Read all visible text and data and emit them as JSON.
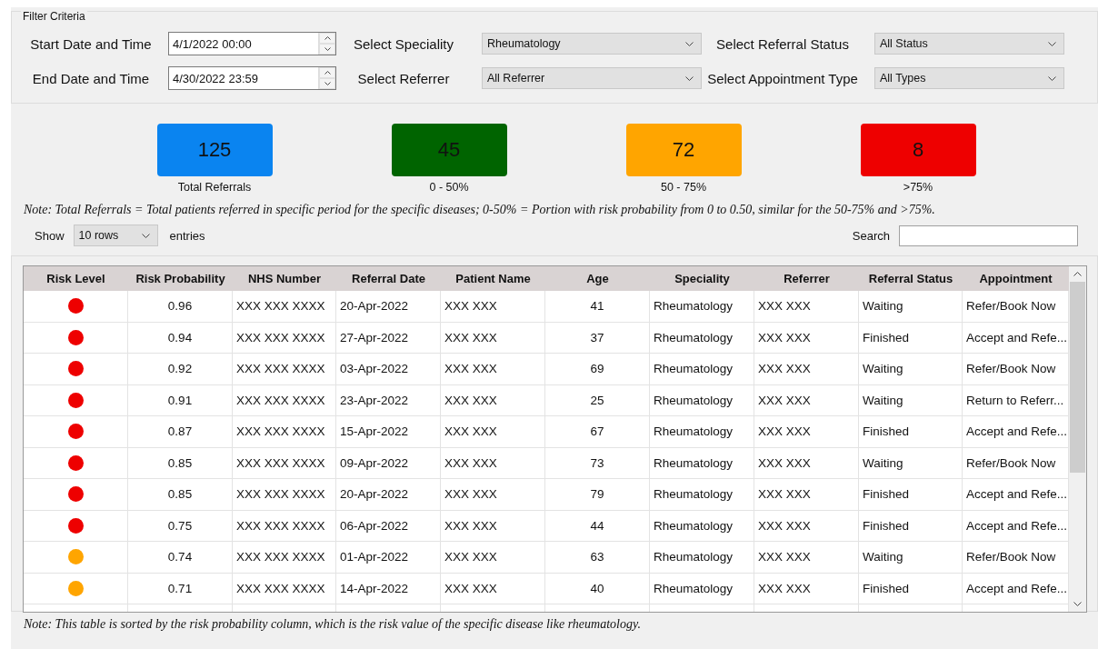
{
  "filter": {
    "title": "Filter Criteria",
    "fields": [
      {
        "kind": "datetime",
        "label": "Start Date and Time",
        "value": "4/1/2022 00:00"
      },
      {
        "kind": "dropdown",
        "label": "Select Speciality",
        "value": "Rheumatology"
      },
      {
        "kind": "dropdown",
        "label": "Select Referral Status",
        "value": "All Status"
      },
      {
        "kind": "datetime",
        "label": "End Date and Time",
        "value": "4/30/2022 23:59"
      },
      {
        "kind": "dropdown",
        "label": "Select Referrer",
        "value": "All Referrer"
      },
      {
        "kind": "dropdown",
        "label": "Select Appointment Type",
        "value": "All Types"
      }
    ]
  },
  "summary_cards": [
    {
      "value": "125",
      "label": "Total Referrals",
      "color": "#0a84f0"
    },
    {
      "value": "45",
      "label": "0 - 50%",
      "color": "#006400"
    },
    {
      "value": "72",
      "label": "50 - 75%",
      "color": "#ffa500"
    },
    {
      "value": "8",
      "label": ">75%",
      "color": "#ee0000"
    }
  ],
  "summary_note": "Note: Total Referrals = Total patients referred in specific period for the specific diseases; 0-50% = Portion with risk probability from 0 to 0.50, similar for the 50-75% and >75%.",
  "entries": {
    "show_label": "Show",
    "value": "10 rows",
    "suffix": "entries"
  },
  "search": {
    "label": "Search"
  },
  "table": {
    "columns": [
      "Risk Level",
      "Risk Probability",
      "NHS Number",
      "Referral Date",
      "Patient Name",
      "Age",
      "Speciality",
      "Referrer",
      "Referral Status",
      "Appointment"
    ],
    "rows": [
      {
        "color": "#ee0000",
        "cells": [
          "",
          "0.96",
          "XXX XXX XXXX",
          "20-Apr-2022",
          "XXX XXX",
          "41",
          "Rheumatology",
          "XXX XXX",
          "Waiting",
          "Refer/Book Now"
        ]
      },
      {
        "color": "#ee0000",
        "cells": [
          "",
          "0.94",
          "XXX XXX XXXX",
          "27-Apr-2022",
          "XXX XXX",
          "37",
          "Rheumatology",
          "XXX XXX",
          "Finished",
          "Accept and Refe..."
        ]
      },
      {
        "color": "#ee0000",
        "cells": [
          "",
          "0.92",
          "XXX XXX XXXX",
          "03-Apr-2022",
          "XXX XXX",
          "69",
          "Rheumatology",
          "XXX XXX",
          "Waiting",
          "Refer/Book Now"
        ]
      },
      {
        "color": "#ee0000",
        "cells": [
          "",
          "0.91",
          "XXX XXX XXXX",
          "23-Apr-2022",
          "XXX XXX",
          "25",
          "Rheumatology",
          "XXX XXX",
          "Waiting",
          "Return to Referr..."
        ]
      },
      {
        "color": "#ee0000",
        "cells": [
          "",
          "0.87",
          "XXX XXX XXXX",
          "15-Apr-2022",
          "XXX XXX",
          "67",
          "Rheumatology",
          "XXX XXX",
          "Finished",
          "Accept and Refe..."
        ]
      },
      {
        "color": "#ee0000",
        "cells": [
          "",
          "0.85",
          "XXX XXX XXXX",
          "09-Apr-2022",
          "XXX XXX",
          "73",
          "Rheumatology",
          "XXX XXX",
          "Waiting",
          "Refer/Book Now"
        ]
      },
      {
        "color": "#ee0000",
        "cells": [
          "",
          "0.85",
          "XXX XXX XXXX",
          "20-Apr-2022",
          "XXX XXX",
          "79",
          "Rheumatology",
          "XXX XXX",
          "Finished",
          "Accept and Refe..."
        ]
      },
      {
        "color": "#ee0000",
        "cells": [
          "",
          "0.75",
          "XXX XXX XXXX",
          "06-Apr-2022",
          "XXX XXX",
          "44",
          "Rheumatology",
          "XXX XXX",
          "Finished",
          "Accept and Refe..."
        ]
      },
      {
        "color": "#ffa500",
        "cells": [
          "",
          "0.74",
          "XXX XXX XXXX",
          "01-Apr-2022",
          "XXX XXX",
          "63",
          "Rheumatology",
          "XXX XXX",
          "Waiting",
          "Refer/Book Now"
        ]
      },
      {
        "color": "#ffa500",
        "cells": [
          "",
          "0.71",
          "XXX XXX XXXX",
          "14-Apr-2022",
          "XXX XXX",
          "40",
          "Rheumatology",
          "XXX XXX",
          "Finished",
          "Accept and Refe..."
        ]
      }
    ]
  },
  "table_note": "Note: This table is sorted by the risk probability column, which is the risk value of the specific disease like rheumatology."
}
